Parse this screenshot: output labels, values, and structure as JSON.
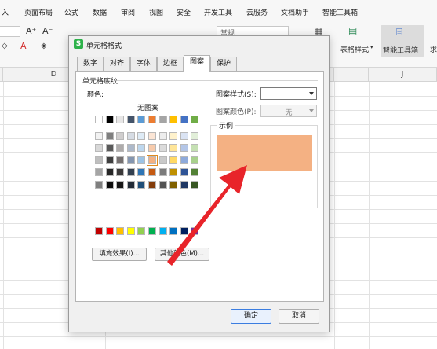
{
  "menubar": {
    "items": [
      "入",
      "页面布局",
      "公式",
      "数据",
      "审阅",
      "视图",
      "安全",
      "开发工具",
      "云服务",
      "文档助手",
      "智能工具箱"
    ]
  },
  "ribbon": {
    "style_box_value": "常规",
    "table_style_label": "表格样式",
    "smart_tool_label": "智能工具箱",
    "font_grow_glyph": "A⁺",
    "font_shrink_glyph": "A⁻",
    "font_color_glyph": "A",
    "right_edge_label": "求"
  },
  "sheet": {
    "columns": [
      "D",
      "I",
      "J"
    ]
  },
  "dialog": {
    "title": "单元格格式",
    "logo_glyph": "S",
    "tabs": [
      "数字",
      "对齐",
      "字体",
      "边框",
      "图案",
      "保护"
    ],
    "active_tab": "图案",
    "group_label": "单元格底纹",
    "color_label": "颜色:",
    "no_pattern_label": "无图案",
    "pattern_style_label": "图案样式(S):",
    "pattern_style_value": "",
    "pattern_color_label": "图案颜色(P):",
    "pattern_color_value": "无",
    "sample_label": "示例",
    "fill_effects_button": "填充效果(I)...",
    "more_colors_button": "其他颜色(M)...",
    "ok_button": "确定",
    "cancel_button": "取消",
    "sample_color": "#f4b183",
    "selected_color": "#f4b183",
    "palette_top": [
      "#ffffff",
      "#000000",
      "#e7e6e6",
      "#44546a",
      "#5b9bd5",
      "#ed7d31",
      "#a5a5a5",
      "#ffc000",
      "#4472c4",
      "#70ad47"
    ],
    "palette_theme": [
      [
        "#f2f2f2",
        "#7f7f7f",
        "#d0cece",
        "#d6dce4",
        "#deebf6",
        "#fbe5d5",
        "#ededed",
        "#fff2cc",
        "#dae3f3",
        "#e2efd9"
      ],
      [
        "#d8d8d8",
        "#595959",
        "#aeabab",
        "#adb9ca",
        "#bdd7ee",
        "#f7cbac",
        "#dbdbdb",
        "#fee599",
        "#b4c6e7",
        "#c5e0b3"
      ],
      [
        "#bfbfbf",
        "#3f3f3f",
        "#757070",
        "#8496b0",
        "#9cc3e5",
        "#f4b183",
        "#c9c9c9",
        "#ffd965",
        "#8eaadb",
        "#a8d08d"
      ],
      [
        "#a5a5a5",
        "#262626",
        "#3a3838",
        "#323f4f",
        "#2e75b5",
        "#c55a11",
        "#7b7b7b",
        "#bf9000",
        "#2f5496",
        "#538135"
      ],
      [
        "#7f7f7f",
        "#0c0c0c",
        "#171616",
        "#222a35",
        "#1e4e79",
        "#833c0b",
        "#525252",
        "#7f6000",
        "#1f3864",
        "#375623"
      ]
    ],
    "palette_standard": [
      "#c00000",
      "#ff0000",
      "#ffc000",
      "#ffff00",
      "#92d050",
      "#00b050",
      "#00b0f0",
      "#0070c0",
      "#002060",
      "#7030a0"
    ]
  },
  "annotation": {
    "arrow_color": "#e8242a"
  }
}
